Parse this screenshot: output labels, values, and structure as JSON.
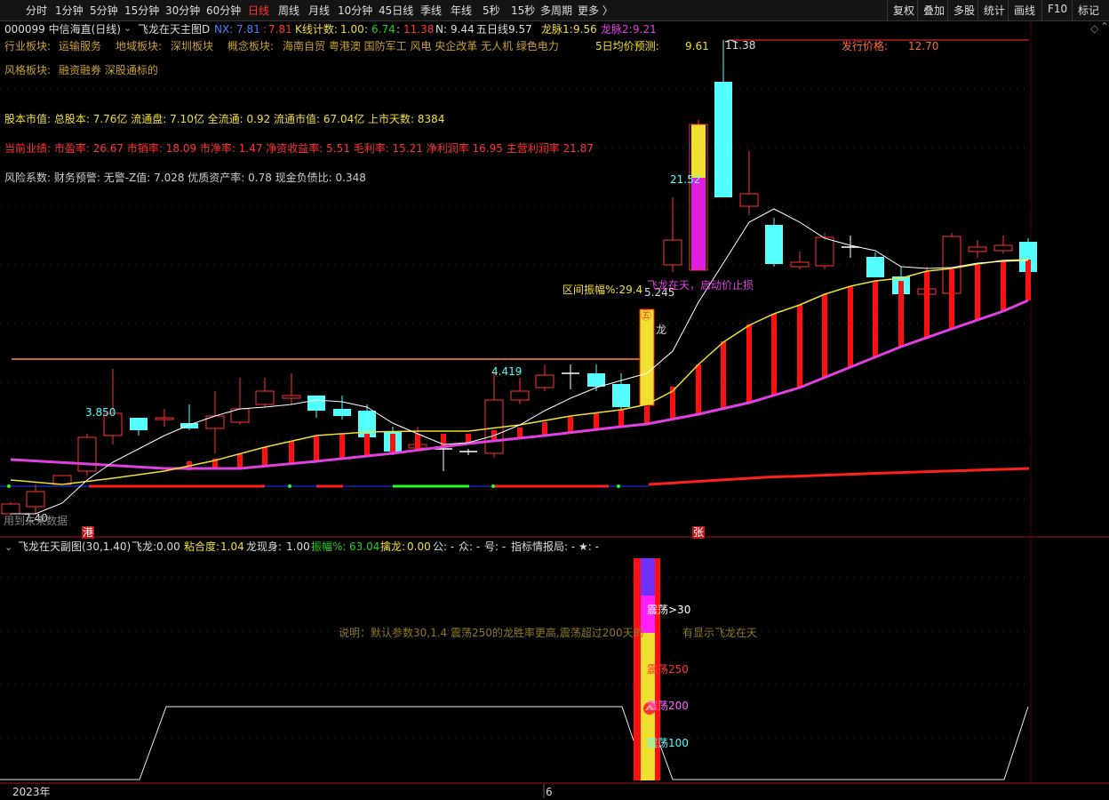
{
  "toolbar": {
    "periods": [
      {
        "label": "分时",
        "active": false
      },
      {
        "label": "1分钟",
        "active": false
      },
      {
        "label": "5分钟",
        "active": false
      },
      {
        "label": "15分钟",
        "active": false
      },
      {
        "label": "30分钟",
        "active": false
      },
      {
        "label": "60分钟",
        "active": false
      },
      {
        "label": "日线",
        "active": true
      },
      {
        "label": "周线",
        "active": false
      },
      {
        "label": "月线",
        "active": false
      },
      {
        "label": "10分钟",
        "active": false
      },
      {
        "label": "45日线",
        "active": false
      },
      {
        "label": "季线",
        "active": false
      },
      {
        "label": "年线",
        "active": false
      },
      {
        "label": "5秒",
        "active": false
      },
      {
        "label": "15秒",
        "active": false
      },
      {
        "label": "多周期",
        "active": false
      },
      {
        "label": "更多 〉",
        "active": false
      }
    ],
    "right_buttons": [
      "复权",
      "叠加",
      "多股",
      "统计",
      "画线",
      "F10",
      "标记"
    ]
  },
  "header": {
    "stock": "000099 中信海直(日线)",
    "indicator": "飞龙在天主图D",
    "nx_label": "NX:",
    "nx_v1": "7.81",
    "nx_v2": "7.81",
    "kline_label": "K线计数:",
    "kline_v1": "1.00",
    "kline_v2": "6.74",
    "kline_v3": "11.38",
    "n_label": "N:",
    "n_value": "9.44",
    "wu_label": "五日线:",
    "wu_value": "9.57",
    "lm1_label": "龙脉1:",
    "lm1_value": "9.56",
    "lm2_label": "龙脉2:",
    "lm2_value": "9.21"
  },
  "info": {
    "industry_label": "行业板块:",
    "industry": "运输服务",
    "region_label": "地域板块:",
    "region": "深圳板块",
    "concept_label": "概念板块:",
    "concept": "海南自贸 粤港澳 国防军工 风电 央企改革 无人机 绿色电力",
    "style_label": "风格板块:",
    "style": "融资融券 深股通标的",
    "forecast_label": "5日均价预测:",
    "forecast_value": "9.61",
    "issue_label": "发行价格:",
    "issue_value": "12.70",
    "capital": "股本市值: 总股本: 7.76亿 流通盘: 7.10亿 全流通: 0.92 流通市值: 67.04亿 上市天数: 8384",
    "performance": "当前业绩: 市盈率: 26.67 市销率: 18.09 市净率: 1.47 净资收益率: 5.51 毛利率: 15.21 净利润率 16.95 主营利润率 21.87",
    "risk": "风险系数: 财务预警: 无警-Z值: 7.028 优质资产率: 0.78 现金负债比: 0.348"
  },
  "annotations": {
    "high": "11.38",
    "p21": "21.52",
    "range_label": "区间振幅%:29.4",
    "p5245": "5.245",
    "p4419": "4.419",
    "p3850": "3.850",
    "low": "7.40",
    "feilong_msg": "飞龙在天，启动价止损",
    "long_tag": "龙",
    "seal_char": "㊄",
    "gang": "港",
    "zhang": "张",
    "no_data": "用到未来数据"
  },
  "sub": {
    "title": "飞龙在天副图(30,1.40)",
    "fl_label": "飞龙:",
    "fl_value": "0.00",
    "nh_label": "粘合度:",
    "nh_value": "1.04",
    "lxs_label": "龙现身:",
    "lxs_value": "1.00",
    "zf_label": "振幅%:",
    "zf_value": "63.04",
    "ql_label": "擒龙:",
    "ql_value": "0.00",
    "gong": "公: -",
    "zhong": "众: -",
    "hao": "号: -",
    "report": "指标情报局: - ★: -",
    "desc": "说明：默认参数30,1.4 震荡250的龙胜率更高,震荡超过200天的",
    "desc2": "有显示飞龙在天",
    "z30": "震荡>30",
    "z250": "震荡250",
    "z200": "震荡200",
    "z100": "震荡100"
  },
  "bottom": {
    "year": "2023年",
    "month": "6"
  },
  "colors": {
    "up": "#ff3333",
    "down": "#54ffff",
    "magenta": "#e040e0",
    "yellow": "#f0e030",
    "white": "#ffffff",
    "orange": "#ff8844",
    "gold": "#c8a030"
  }
}
